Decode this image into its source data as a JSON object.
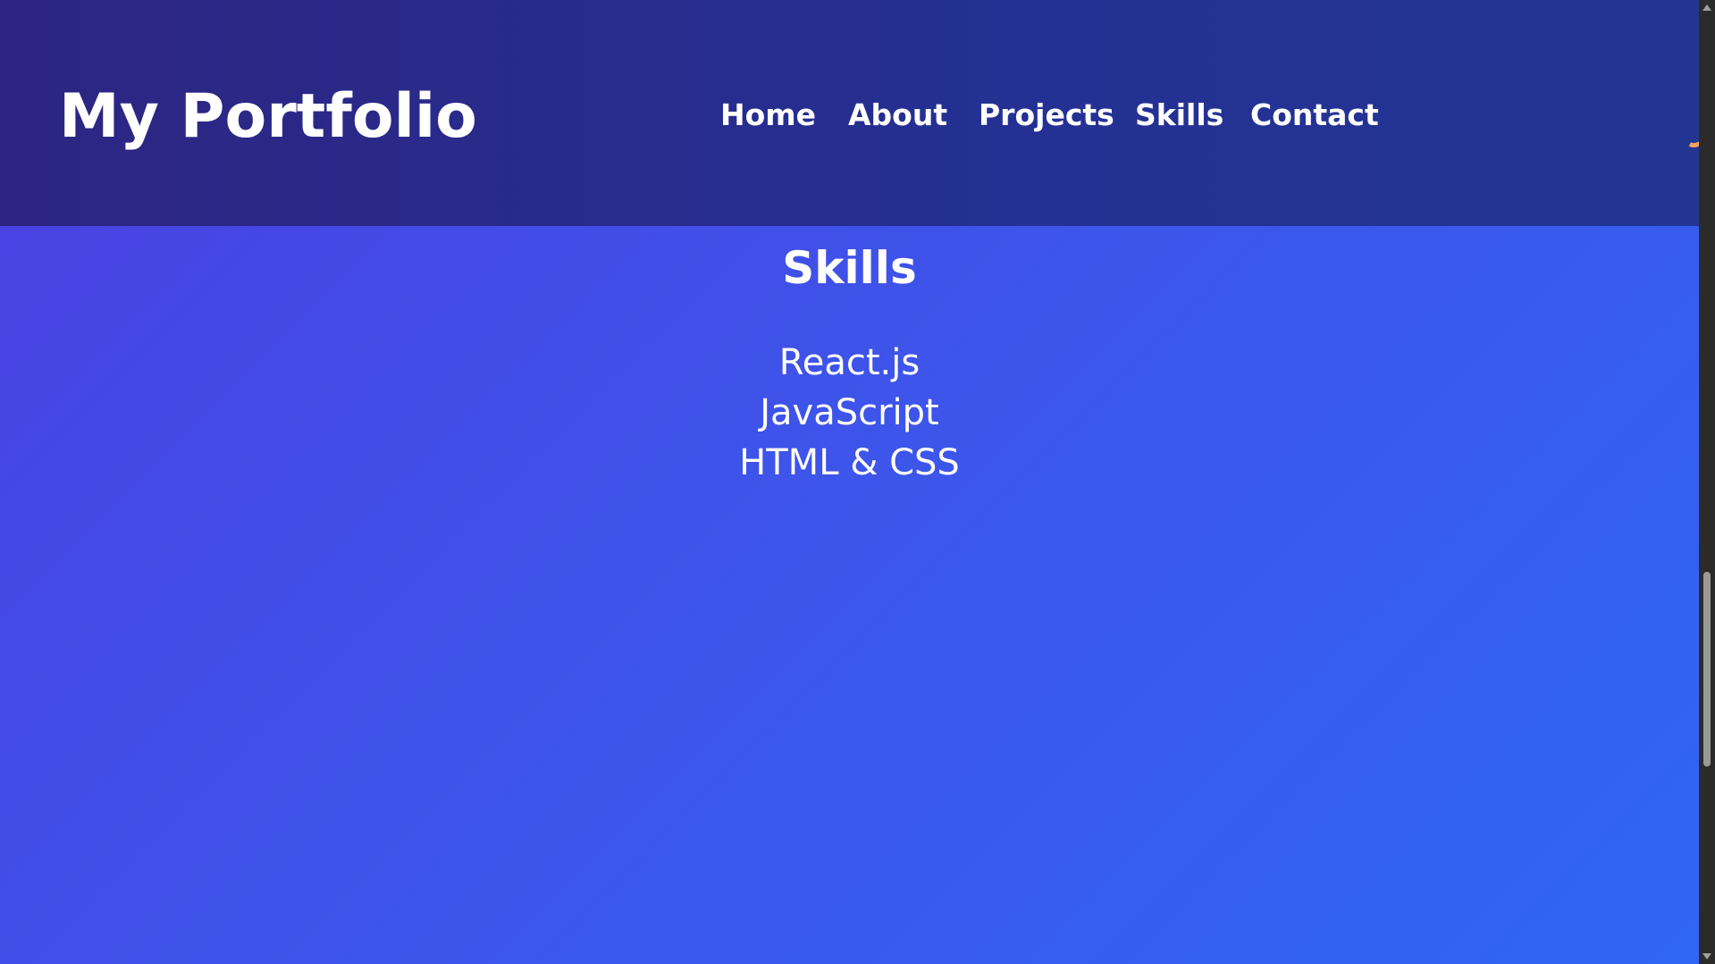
{
  "header": {
    "brand": "My Portfolio",
    "nav": [
      {
        "label": "Home"
      },
      {
        "label": "About"
      },
      {
        "label": "Projects"
      },
      {
        "label": "Skills"
      },
      {
        "label": "Contact"
      }
    ]
  },
  "skills_section": {
    "title": "Skills",
    "items": [
      "React.js",
      "JavaScript",
      "HTML & CSS"
    ]
  },
  "colors": {
    "header_bg": "#26308f",
    "page_gradient_start": "#4a3fe0",
    "page_gradient_end": "#2f66f4",
    "accent": "#f5a15a",
    "text": "#ffffff"
  }
}
